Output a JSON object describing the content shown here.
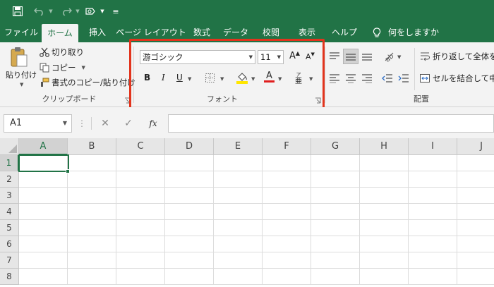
{
  "colors": {
    "accent": "#217346",
    "highlight_frame": "#e2341d",
    "underline_red": "#e01e1e",
    "highlight_yellow": "#ffe600"
  },
  "quick_access": {
    "icons": [
      "save-icon",
      "undo-icon",
      "redo-icon",
      "touch-mode-icon",
      "customize-icon"
    ]
  },
  "menu": {
    "tabs": [
      "ファイル",
      "ホーム",
      "挿入",
      "ページ レイアウト",
      "数式",
      "データ",
      "校閲",
      "表示",
      "ヘルプ"
    ],
    "active_tab": "ホーム",
    "tell_me": "何をしますか"
  },
  "ribbon": {
    "clipboard": {
      "paste": "貼り付け",
      "cut": "切り取り",
      "copy": "コピー",
      "format_painter": "書式のコピー/貼り付け",
      "group_label": "クリップボード"
    },
    "font": {
      "font_name": "游ゴシック",
      "font_size": "11",
      "bold": "B",
      "italic": "I",
      "underline": "U",
      "grow_label": "A",
      "shrink_label": "A",
      "font_color_label": "A",
      "phonetic_label": "亜",
      "group_label": "フォント"
    },
    "alignment": {
      "wrap_text": "折り返して全体を表",
      "merge_center": "セルを結合して中央",
      "group_label": "配置"
    }
  },
  "formula_bar": {
    "name_box": "A1",
    "cancel": "✕",
    "enter": "✓",
    "fx": "fx",
    "value": ""
  },
  "sheet": {
    "columns": [
      "A",
      "B",
      "C",
      "D",
      "E",
      "F",
      "G",
      "H",
      "I",
      "J"
    ],
    "rows": [
      "1",
      "2",
      "3",
      "4",
      "5",
      "6",
      "7",
      "8"
    ],
    "selected_cell": "A1"
  }
}
